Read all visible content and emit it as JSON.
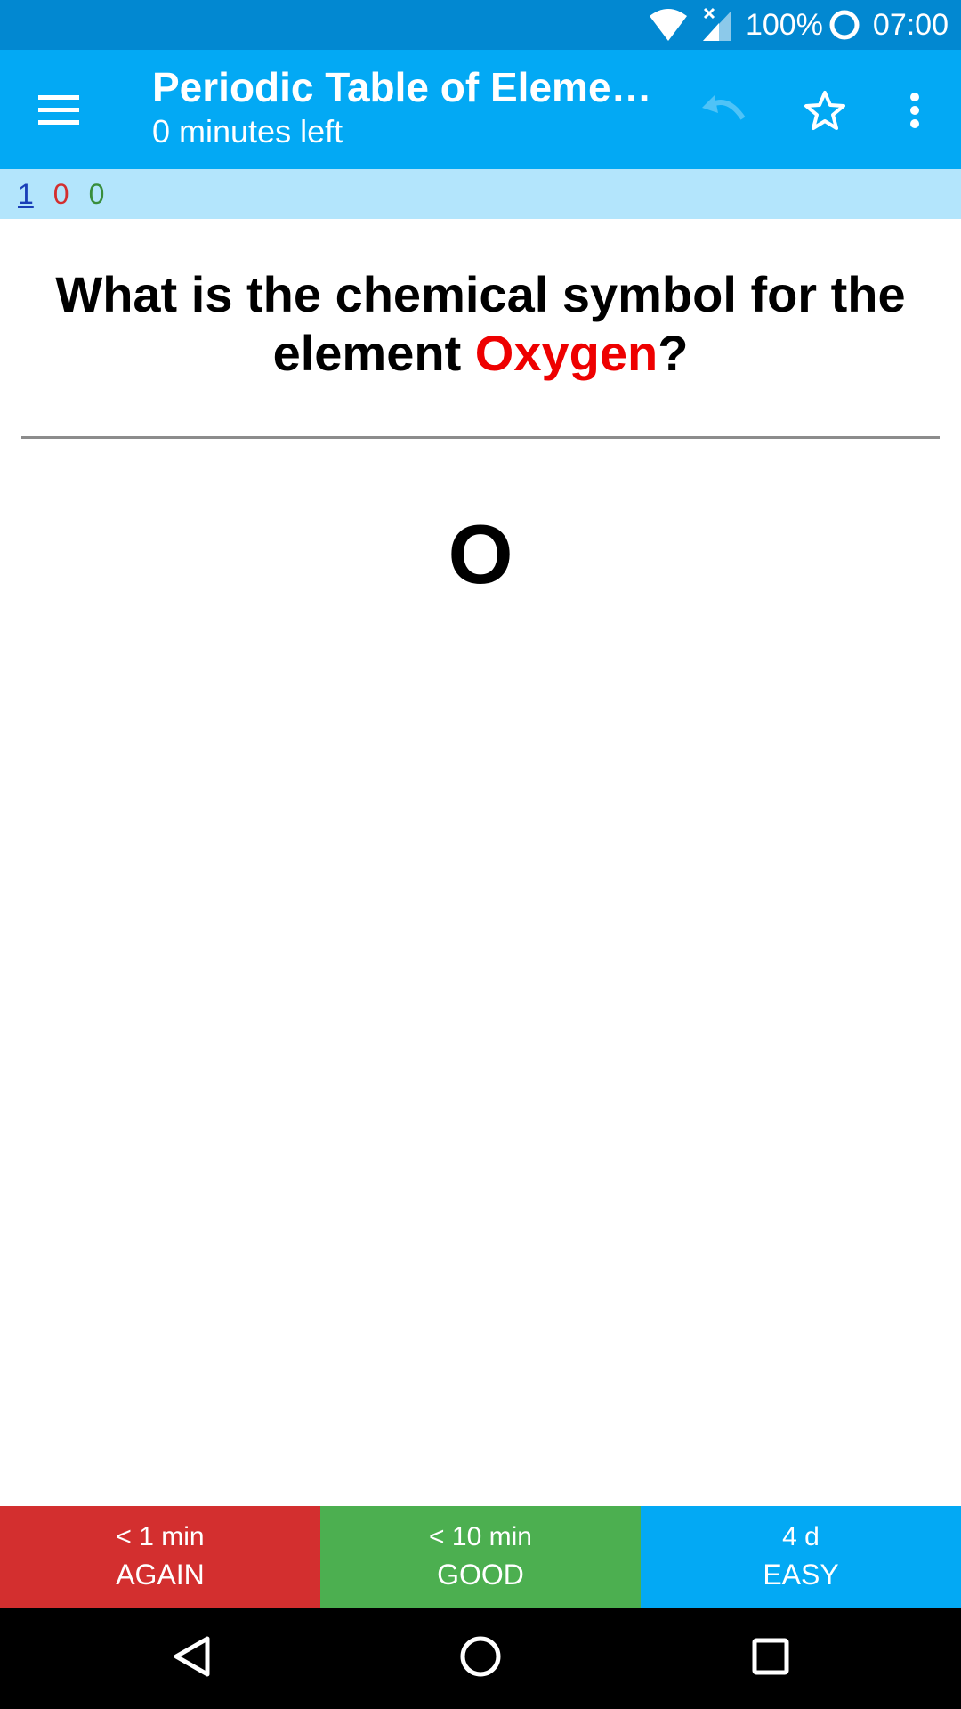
{
  "status_bar": {
    "battery": "100%",
    "time": "07:00"
  },
  "app_bar": {
    "title": "Periodic Table of Elements",
    "subtitle": "0 minutes left",
    "icons": [
      "menu-icon",
      "undo-icon",
      "star-outline-icon",
      "more-vertical-icon"
    ]
  },
  "counts": {
    "new": "1",
    "learning": "0",
    "review": "0"
  },
  "card": {
    "question_prefix": "What is the chemical symbol for the element ",
    "question_highlight": "Oxygen",
    "question_suffix": "?",
    "answer": "O"
  },
  "ease_buttons": {
    "again": {
      "interval": "< 1 min",
      "label": "AGAIN"
    },
    "good": {
      "interval": "< 10 min",
      "label": "GOOD"
    },
    "easy": {
      "interval": "4 d",
      "label": "EASY"
    }
  },
  "colors": {
    "status_bar": "#0288d1",
    "app_bar": "#03a9f4",
    "counts_bar": "#b3e5fc",
    "highlight": "#ee0000",
    "again": "#d32f2f",
    "good": "#4caf50",
    "easy": "#03a9f4"
  }
}
